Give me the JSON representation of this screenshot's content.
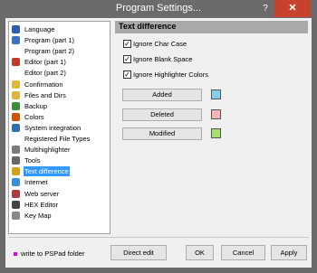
{
  "window": {
    "title": "Program Settings...",
    "help_glyph": "?",
    "close_glyph": "✕"
  },
  "tree": {
    "items": [
      {
        "label": "Language",
        "icon": "flag-icon",
        "color": "#2b5fb8"
      },
      {
        "label": "Program  (part 1)",
        "icon": "window-icon",
        "color": "#3a6fc4"
      },
      {
        "label": "Program  (part 2)",
        "icon": "",
        "color": ""
      },
      {
        "label": "Editor  (part 1)",
        "icon": "pencil-icon",
        "color": "#c0392b"
      },
      {
        "label": "Editor  (part 2)",
        "icon": "",
        "color": ""
      },
      {
        "label": "Confirmation",
        "icon": "chat-bubble-icon",
        "color": "#e2b73a"
      },
      {
        "label": "Files and Dirs",
        "icon": "folder-icon",
        "color": "#e0b340"
      },
      {
        "label": "Backup",
        "icon": "backup-icon",
        "color": "#3b8f3b"
      },
      {
        "label": "Colors",
        "icon": "palette-icon",
        "color": "#d35400"
      },
      {
        "label": "System integration",
        "icon": "monitor-icon",
        "color": "#2e6fb5"
      },
      {
        "label": "Registered File Types",
        "icon": "",
        "color": ""
      },
      {
        "label": "Multihighlighter",
        "icon": "highlighter-icon",
        "color": "#7a7a7a"
      },
      {
        "label": "Tools",
        "icon": "tools-icon",
        "color": "#666666"
      },
      {
        "label": "Text difference",
        "icon": "text-diff-icon",
        "color": "#d4a017"
      },
      {
        "label": "Internet",
        "icon": "globe-icon",
        "color": "#3a8fd8"
      },
      {
        "label": "Web server",
        "icon": "web-server-icon",
        "color": "#b23a3a"
      },
      {
        "label": "HEX Editor",
        "icon": "hex-icon",
        "color": "#444444"
      },
      {
        "label": "Key Map",
        "icon": "key-icon",
        "color": "#888888"
      }
    ],
    "selected_index": 13
  },
  "panel": {
    "title": "Text difference",
    "check_mark": "✓",
    "checkboxes": [
      {
        "label": "Ignore Char Case",
        "checked": true
      },
      {
        "label": "Ignore Blank Space",
        "checked": true
      },
      {
        "label": "Ignore Highlighter Colors",
        "checked": true
      }
    ],
    "color_buttons": [
      {
        "label": "Added",
        "color": "#87ceeb"
      },
      {
        "label": "Deleted",
        "color": "#f4b6b6"
      },
      {
        "label": "Modified",
        "color": "#a8e070"
      }
    ]
  },
  "footer": {
    "write_to_folder_label": "write to PSPad folder",
    "write_to_folder_checked": false,
    "direct_edit_label": "Direct edit",
    "ok_label": "OK",
    "cancel_label": "Cancel",
    "apply_label": "Apply"
  }
}
